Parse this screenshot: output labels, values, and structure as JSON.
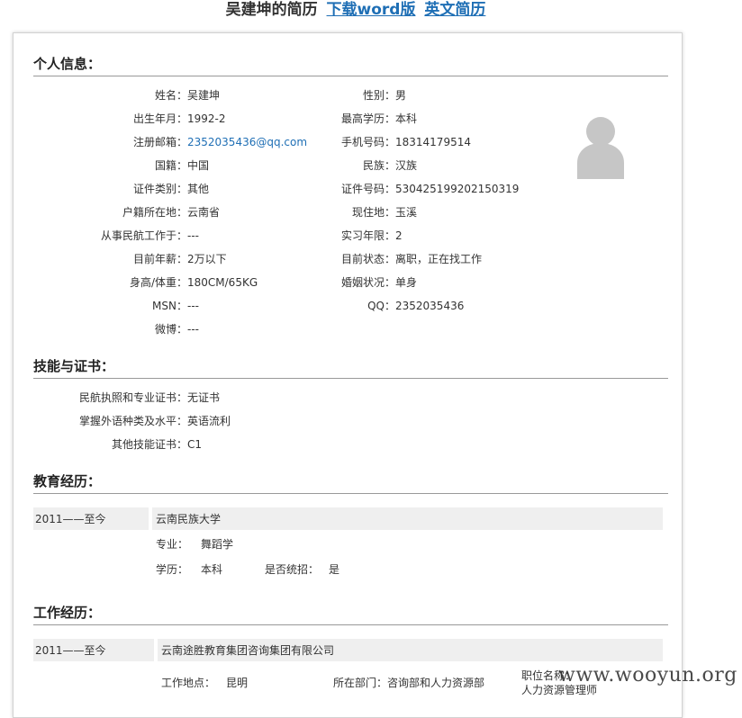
{
  "header": {
    "name_title": "吴建坤的简历",
    "download_word": "下载word版",
    "english_resume": "英文简历"
  },
  "personal": {
    "heading": "个人信息：",
    "left": [
      {
        "label": "姓名：",
        "value": "吴建坤"
      },
      {
        "label": "出生年月：",
        "value": "1992-2"
      },
      {
        "label": "注册邮箱：",
        "value": "2352035436@qq.com"
      },
      {
        "label": "国籍：",
        "value": "中国"
      },
      {
        "label": "证件类别：",
        "value": "其他"
      },
      {
        "label": "户籍所在地：",
        "value": "云南省"
      },
      {
        "label": "从事民航工作于：",
        "value": "---"
      },
      {
        "label": "目前年薪：",
        "value": "2万以下"
      },
      {
        "label": "身高/体重：",
        "value": "180CM/65KG"
      },
      {
        "label": "MSN：",
        "value": "---"
      },
      {
        "label": "微博：",
        "value": "---"
      }
    ],
    "right": [
      {
        "label": "性别：",
        "value": "男"
      },
      {
        "label": "最高学历：",
        "value": "本科"
      },
      {
        "label": "手机号码：",
        "value": "18314179514"
      },
      {
        "label": "民族：",
        "value": "汉族"
      },
      {
        "label": "证件号码：",
        "value": "530425199202150319"
      },
      {
        "label": "现住地：",
        "value": "玉溪"
      },
      {
        "label": "实习年限：",
        "value": "2"
      },
      {
        "label": "目前状态：",
        "value": "离职，正在找工作"
      },
      {
        "label": "婚姻状况：",
        "value": "单身"
      },
      {
        "label": "QQ：",
        "value": "2352035436"
      }
    ]
  },
  "skills": {
    "heading": "技能与证书：",
    "items": [
      {
        "label": "民航执照和专业证书：",
        "value": "无证书"
      },
      {
        "label": "掌握外语种类及水平：",
        "value": "英语流利"
      },
      {
        "label": "其他技能证书：",
        "value": "C1"
      }
    ]
  },
  "education": {
    "heading": "教育经历：",
    "period": "2011——至今",
    "school": "云南民族大学",
    "major_label": "专业：",
    "major": "舞蹈学",
    "degree_label": "学历：",
    "degree": "本科",
    "unified_label": "是否统招：",
    "unified": "是"
  },
  "work": {
    "heading": "工作经历：",
    "period": "2011——至今",
    "company": "云南途胜教育集团咨询集团有限公司",
    "location_label": "工作地点：",
    "location": "昆明",
    "dept_label": "所在部门：",
    "dept": "咨询部和人力资源部",
    "title_label": "职位名称：",
    "title": "人力资源管理师"
  },
  "watermark": "www.wooyun.org"
}
